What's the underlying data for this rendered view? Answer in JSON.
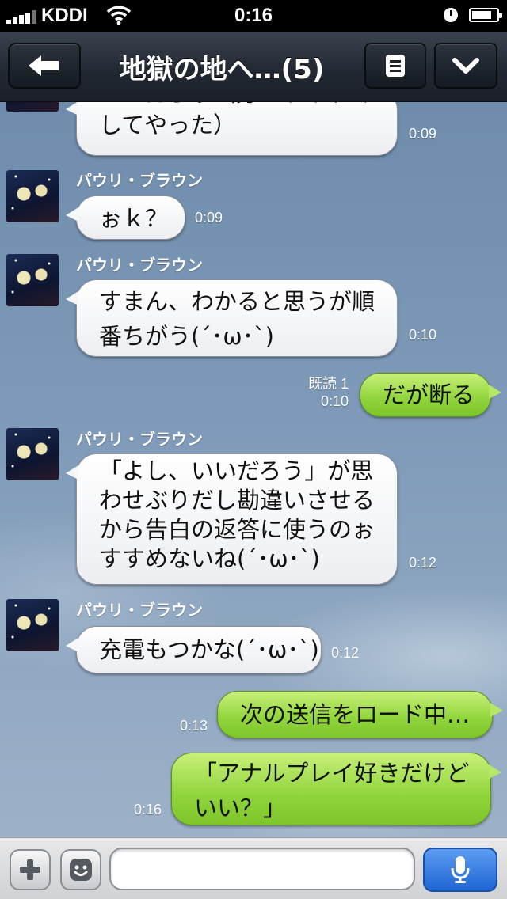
{
  "status_bar": {
    "carrier": "KDDI",
    "time": "0:16",
    "battery_level": 0.8
  },
  "nav": {
    "title": "地獄の地へ…(5)",
    "icons": {
      "back": "back-arrow-icon",
      "menu": "menu-icon",
      "more": "chevron-down-icon"
    }
  },
  "messages": [
    {
      "direction": "in",
      "lines": [
        "いいだろぅ（分かりやすく",
        "してやった）"
      ],
      "time": "0:09"
    },
    {
      "direction": "in",
      "sender": "パウリ・ブラウン",
      "lines": [
        "ぉｋ？"
      ],
      "time": "0:09"
    },
    {
      "direction": "in",
      "sender": "パウリ・ブラウン",
      "lines": [
        "すまん、わかると思うが順",
        "番ちがう(´･ω･`)"
      ],
      "time": "0:10"
    },
    {
      "direction": "out",
      "lines": [
        "だが断る"
      ],
      "read": "既読 1",
      "time": "0:10"
    },
    {
      "direction": "in",
      "sender": "パウリ・ブラウン",
      "lines": [
        "「よし、いいだろう」が思",
        "わせぶりだし勘違いさせる",
        "から告白の返答に使うのぉ",
        "すすめないね(´･ω･`)"
      ],
      "time": "0:12"
    },
    {
      "direction": "in",
      "sender": "パウリ・ブラウン",
      "lines": [
        "充電もつかな(´･ω･`)"
      ],
      "time": "0:12"
    },
    {
      "direction": "out",
      "lines": [
        "次の送信をロード中…"
      ],
      "time": "0:13"
    },
    {
      "direction": "out",
      "lines": [
        "「アナルプレイ好きだけど",
        "いい？」"
      ],
      "time": "0:16"
    }
  ],
  "input_bar": {
    "placeholder": "",
    "icons": {
      "add": "plus-icon",
      "sticker": "emoji-icon",
      "voice": "microphone-icon"
    }
  },
  "colors": {
    "nav_bg": "#232933",
    "outgoing_bubble": "#8fd43a",
    "incoming_bubble": "#ffffff",
    "mic_button": "#1f66d3"
  }
}
